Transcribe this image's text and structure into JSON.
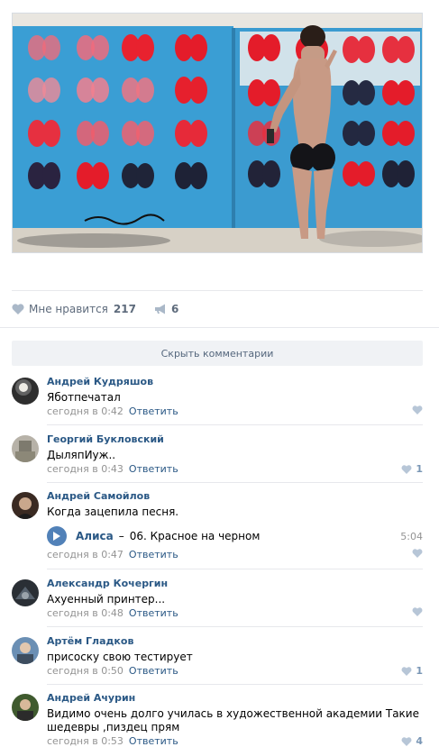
{
  "post": {
    "image_icon": "photo-painting",
    "likes_label": "Мне нравится",
    "likes_count": "217",
    "shares_count": "6",
    "hide_comments_label": "Скрыть комментарии"
  },
  "comments": [
    {
      "author": "Андрей Кудряшов",
      "text": "Яботпечатал",
      "time": "сегодня в 0:42",
      "reply": "Ответить",
      "likes": ""
    },
    {
      "author": "Георгий Букловский",
      "text": "ДыляпИуж..",
      "time": "сегодня в 0:43",
      "reply": "Ответить",
      "likes": "1"
    },
    {
      "author": "Андрей Самойлов",
      "text": "Когда зацепила песня.",
      "time": "сегодня в 0:47",
      "reply": "Ответить",
      "likes": "",
      "audio": {
        "artist": "Алиса",
        "dash": "–",
        "title": "06. Красное на черном",
        "duration": "5:04"
      }
    },
    {
      "author": "Александр Кочергин",
      "text": "Ахуенный принтер...",
      "time": "сегодня в 0:48",
      "reply": "Ответить",
      "likes": ""
    },
    {
      "author": "Артём Гладков",
      "text": "присоску свою тестирует",
      "time": "сегодня в 0:50",
      "reply": "Ответить",
      "likes": "1"
    },
    {
      "author": "Андрей Ачурин",
      "text": "Видимо очень долго училась в художественной академии Такие шедевры ,пиздец прям",
      "time": "сегодня в 0:53",
      "reply": "Ответить",
      "likes": "4"
    }
  ],
  "colors": {
    "link": "#2a5885",
    "meta": "#939393",
    "accent": "#5181b8",
    "canvas_blue": "#3a9ed4"
  }
}
